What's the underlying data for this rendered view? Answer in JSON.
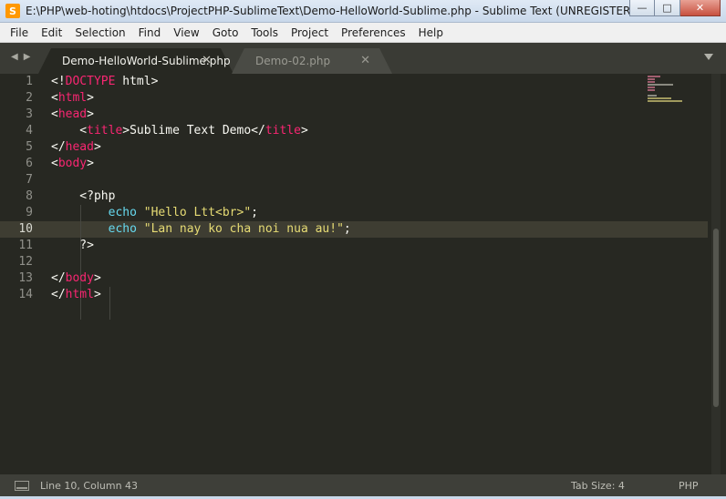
{
  "window": {
    "title": "E:\\PHP\\web-hoting\\htdocs\\ProjectPHP-SublimeText\\Demo-HelloWorld-Sublime.php - Sublime Text (UNREGISTERED)",
    "app_icon_letter": "S",
    "minimize_glyph": "—",
    "maximize_glyph": "□",
    "close_glyph": "✕"
  },
  "menu": [
    "File",
    "Edit",
    "Selection",
    "Find",
    "View",
    "Goto",
    "Tools",
    "Project",
    "Preferences",
    "Help"
  ],
  "nav": {
    "back": "◀",
    "forward": "▶"
  },
  "tabs": [
    {
      "label": "Demo-HelloWorld-Sublime.php",
      "close": "✕",
      "active": true
    },
    {
      "label": "Demo-02.php",
      "close": "✕",
      "active": false
    }
  ],
  "editor": {
    "current_line": 10,
    "lines": [
      [
        {
          "t": "<!",
          "c": "txt"
        },
        {
          "t": "DOCTYPE",
          "c": "tag"
        },
        {
          "t": " html>",
          "c": "txt"
        }
      ],
      [
        {
          "t": "<",
          "c": "txt"
        },
        {
          "t": "html",
          "c": "tag"
        },
        {
          "t": ">",
          "c": "txt"
        }
      ],
      [
        {
          "t": "<",
          "c": "txt"
        },
        {
          "t": "head",
          "c": "tag"
        },
        {
          "t": ">",
          "c": "txt"
        }
      ],
      [
        {
          "t": "    <",
          "c": "txt"
        },
        {
          "t": "title",
          "c": "tag"
        },
        {
          "t": ">Sublime Text Demo</",
          "c": "txt"
        },
        {
          "t": "title",
          "c": "tag"
        },
        {
          "t": ">",
          "c": "txt"
        }
      ],
      [
        {
          "t": "</",
          "c": "txt"
        },
        {
          "t": "head",
          "c": "tag"
        },
        {
          "t": ">",
          "c": "txt"
        }
      ],
      [
        {
          "t": "<",
          "c": "txt"
        },
        {
          "t": "body",
          "c": "tag"
        },
        {
          "t": ">",
          "c": "txt"
        }
      ],
      [],
      [
        {
          "t": "    <?php",
          "c": "txt"
        }
      ],
      [
        {
          "t": "        ",
          "c": "txt"
        },
        {
          "t": "echo",
          "c": "kw"
        },
        {
          "t": " ",
          "c": "txt"
        },
        {
          "t": "\"Hello Ltt<br>\"",
          "c": "str"
        },
        {
          "t": ";",
          "c": "txt"
        }
      ],
      [
        {
          "t": "        ",
          "c": "txt"
        },
        {
          "t": "echo",
          "c": "kw"
        },
        {
          "t": " ",
          "c": "txt"
        },
        {
          "t": "\"Lan nay ko cha noi nua au!\"",
          "c": "str"
        },
        {
          "t": ";",
          "c": "txt"
        }
      ],
      [
        {
          "t": "    ?>",
          "c": "txt"
        }
      ],
      [],
      [
        {
          "t": "</",
          "c": "txt"
        },
        {
          "t": "body",
          "c": "tag"
        },
        {
          "t": ">",
          "c": "txt"
        }
      ],
      [
        {
          "t": "</",
          "c": "txt"
        },
        {
          "t": "html",
          "c": "tag"
        },
        {
          "t": ">",
          "c": "txt"
        }
      ]
    ]
  },
  "status": {
    "position": "Line 10, Column 43",
    "tab_size": "Tab Size: 4",
    "syntax": "PHP"
  },
  "colors": {
    "background": "#272822",
    "tag": "#f92672",
    "string": "#e6db74",
    "keyword": "#66d9ef",
    "text": "#f8f8f2"
  }
}
